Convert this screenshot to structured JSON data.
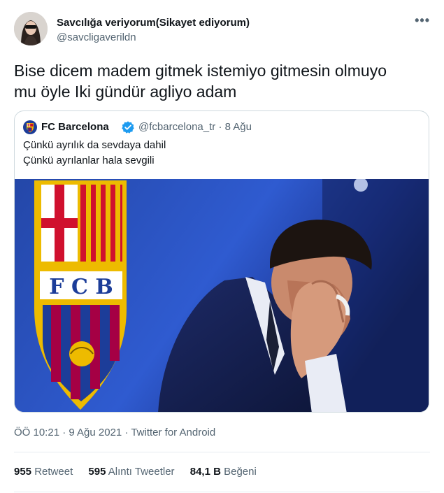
{
  "author": {
    "name": "Savcılığa veriyorum(Sikayet ediyorum)",
    "handle": "@savcligaverildn"
  },
  "menu": {
    "more_glyph": "•••"
  },
  "tweet": {
    "text_line1": "Bise dicem madem gitmek istemiyo gitmesin olmuyo",
    "text_line2": "mu öyle Iki gündür agliyo adam"
  },
  "quoted": {
    "name": "FC Barcelona",
    "handle": "@fcbarcelona_tr",
    "separator": "·",
    "date": "8 Ağu",
    "line1": "Çünkü ayrılık da sevdaya dahil",
    "line2": "Çünkü ayrılanlar hala sevgili",
    "verified": true
  },
  "meta": {
    "text": "ÖÖ 10:21 · 9 Ağu 2021 · Twitter for Android"
  },
  "stats": {
    "retweets_count": "955",
    "retweets_label": "Retweet",
    "quotes_count": "595",
    "quotes_label": "Alıntı Tweetler",
    "likes_count": "84,1 B",
    "likes_label": "Beğeni"
  },
  "colors": {
    "text_primary": "#0f1419",
    "text_secondary": "#536471",
    "verified_blue": "#1d9bf0",
    "border": "#cfd9de",
    "fcb_blue": "#1c3d99",
    "fcb_red": "#a50044",
    "fcb_gold": "#edbb00"
  }
}
